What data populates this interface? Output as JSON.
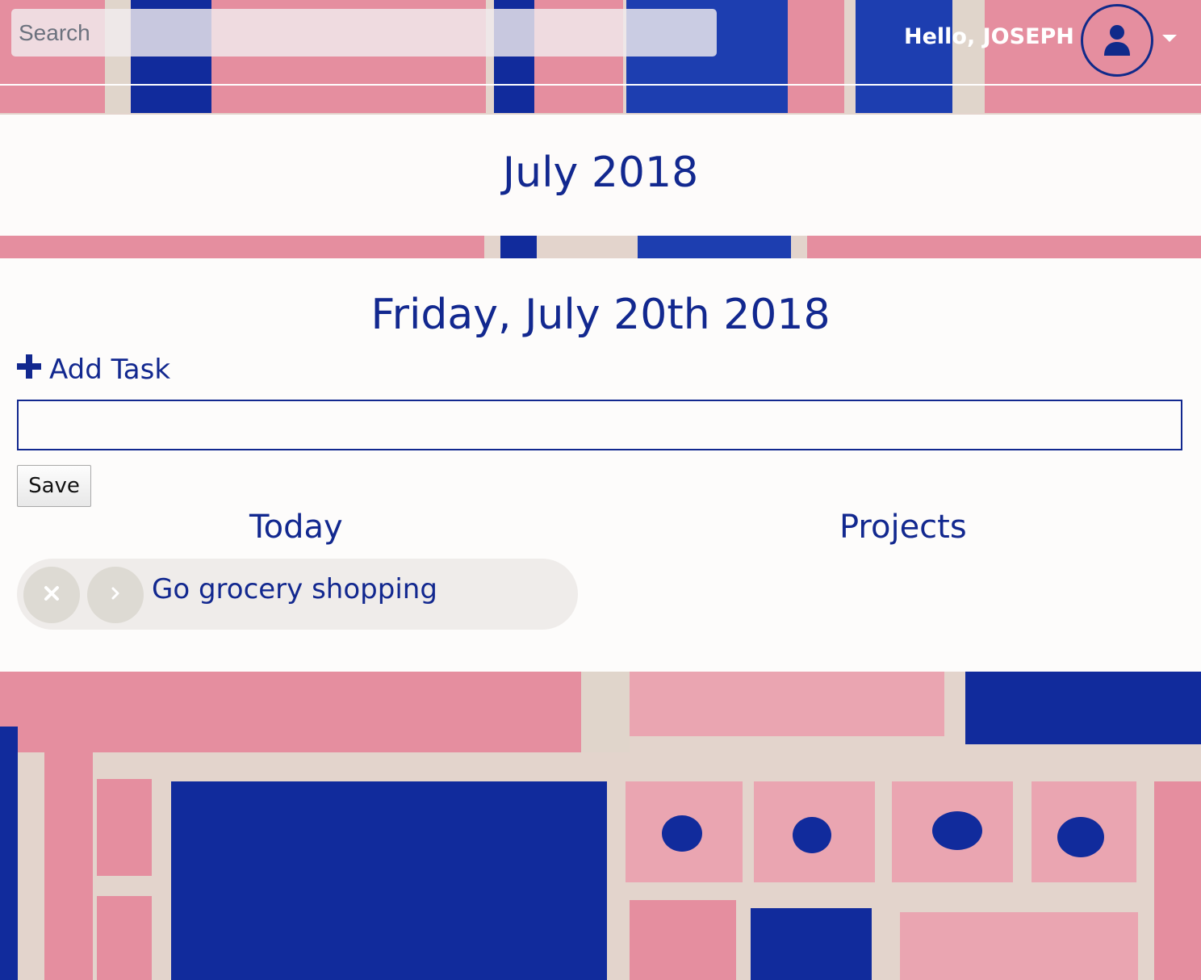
{
  "nav": {
    "search_placeholder": "Search",
    "greeting": "Hello, JOSEPH"
  },
  "month": {
    "title": "July 2018"
  },
  "day": {
    "title": "Friday, July 20th 2018",
    "add_task_label": "Add Task",
    "task_input_value": "",
    "save_label": "Save",
    "today_heading": "Today",
    "projects_heading": "Projects",
    "tasks": [
      {
        "text": "Go grocery shopping"
      }
    ]
  },
  "colors": {
    "accent": "#12288f",
    "panel": "#ffffff"
  },
  "icons": {
    "avatar": "user-icon",
    "dropdown": "caret-down-icon",
    "add": "plus-icon",
    "delete": "close-icon",
    "move": "chevron-right-icon"
  }
}
